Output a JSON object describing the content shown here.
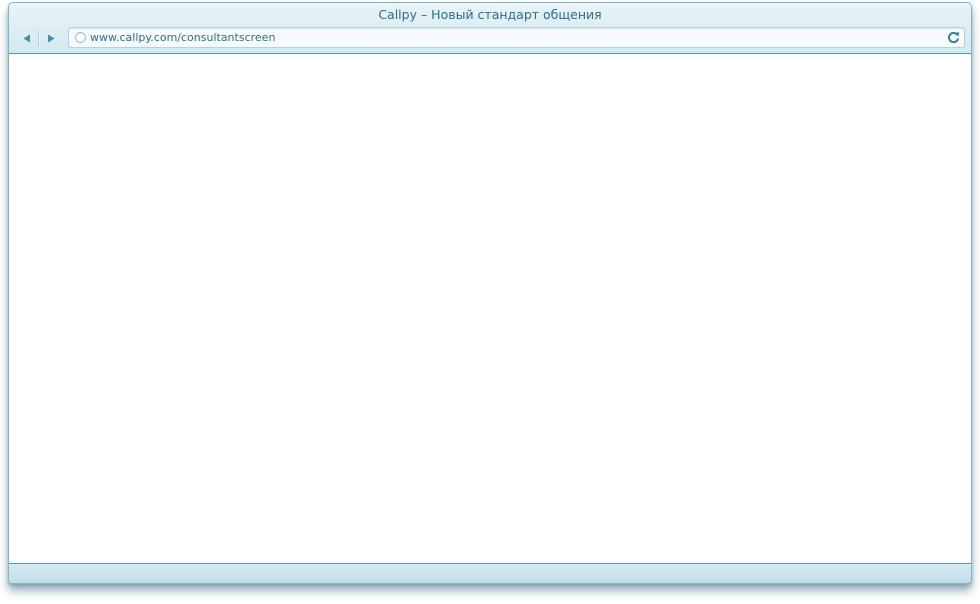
{
  "window": {
    "title": "Callpy – Новый стандарт общения"
  },
  "toolbar": {
    "back_icon": "triangle-left-icon",
    "forward_icon": "triangle-right-icon",
    "reload_icon": "reload-icon"
  },
  "addressbar": {
    "url": "www.callpy.com/consultantscreen",
    "site_icon": "circle-icon"
  },
  "colors": {
    "accent": "#4f9ab6",
    "text": "#2d6d87",
    "chrome_top": "#e9f4f8",
    "chrome_bottom": "#d3e8f0"
  }
}
